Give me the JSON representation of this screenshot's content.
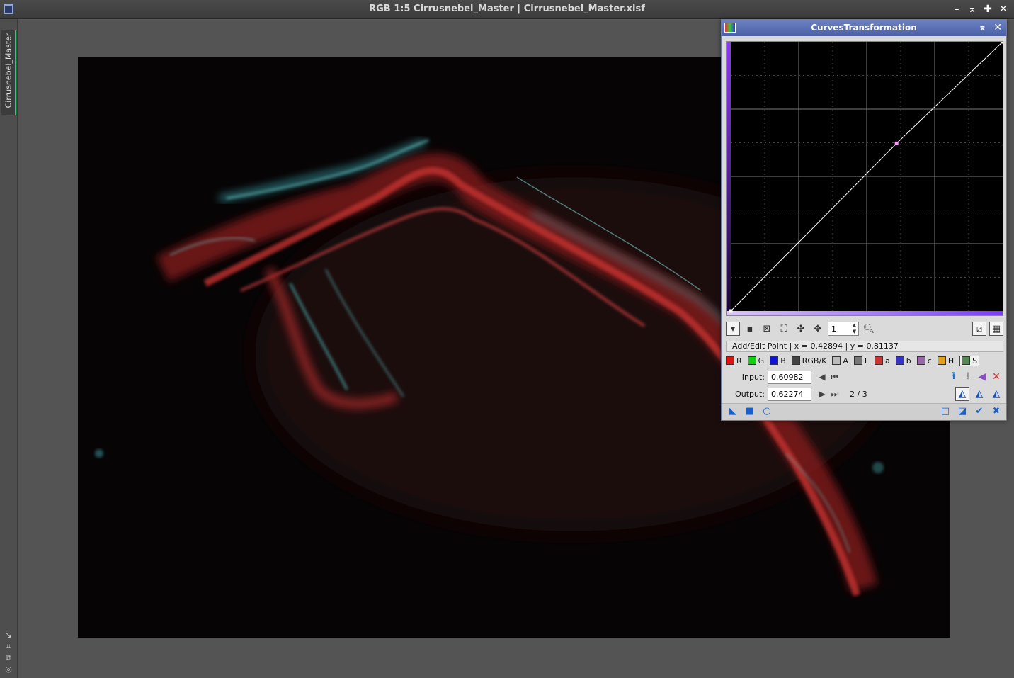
{
  "window": {
    "title": "RGB 1:5 Cirrusnebel_Master | Cirrusnebel_Master.xisf",
    "buttons": [
      "minimize-icon",
      "shade-icon",
      "maximize-icon",
      "close-icon"
    ]
  },
  "sidebar": {
    "tab_label": "Cirrusnebel_Master",
    "tools": [
      "arrow-icon",
      "fit-icon",
      "copy-icon",
      "circle-icon"
    ]
  },
  "image": {
    "description_icon": "nebula-image"
  },
  "curves": {
    "title": "CurvesTransformation",
    "zoom_value": "1",
    "status_text": "Add/Edit Point | x = 0.42894 | y = 0.81137",
    "channels": [
      {
        "label": "R",
        "color": "#e01010"
      },
      {
        "label": "G",
        "color": "#10d010"
      },
      {
        "label": "B",
        "color": "#1010e0"
      },
      {
        "label": "RGB/K",
        "color": "#444444"
      },
      {
        "label": "A",
        "color": "#bbbbbb"
      },
      {
        "label": "L",
        "color": "#777777"
      },
      {
        "label": "a",
        "color": "#cc3333"
      },
      {
        "label": "b",
        "color": "#3333cc"
      },
      {
        "label": "c",
        "color": "#9966aa"
      },
      {
        "label": "H",
        "color": "#e0a020"
      },
      {
        "label": "S",
        "color": "#558855"
      }
    ],
    "selected_channel": "S",
    "input_label": "Input:",
    "input_value": "0.60982",
    "output_label": "Output:",
    "output_value": "0.62274",
    "point_count": "2 / 3",
    "curve": {
      "points": [
        [
          0,
          0
        ],
        [
          0.60982,
          0.62274
        ],
        [
          1,
          1
        ]
      ],
      "line_color": "#ffffff",
      "point_color": "#ff99ff",
      "gradient_color": "#7b3fe0"
    }
  }
}
